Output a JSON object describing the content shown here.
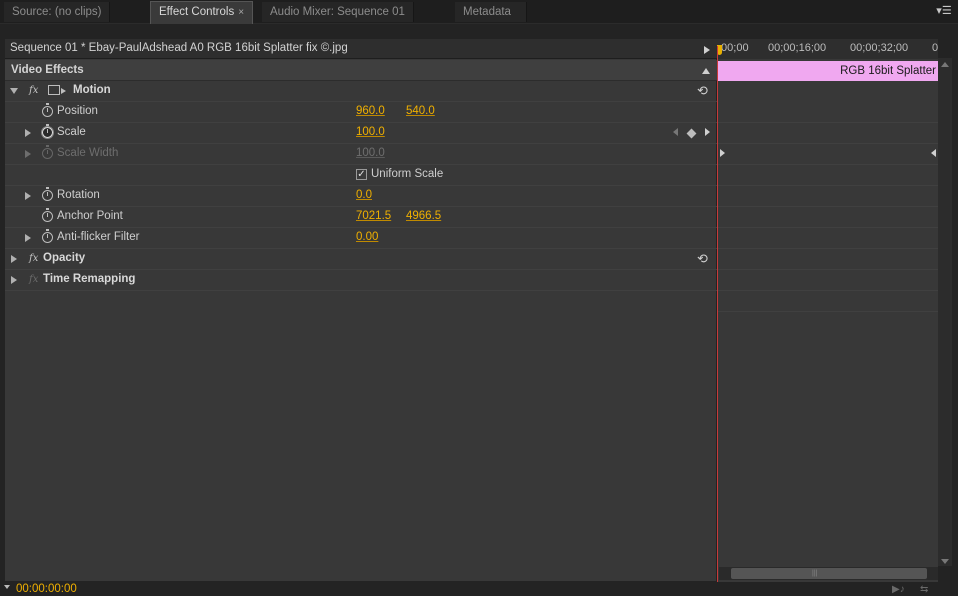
{
  "tabs": [
    {
      "label": "Source: (no clips)",
      "active": false
    },
    {
      "label": "Effect Controls",
      "active": true,
      "close": "×"
    },
    {
      "label": "Audio Mixer: Sequence 01",
      "active": false
    },
    {
      "label": "Metadata",
      "active": false
    }
  ],
  "panel_menu_icon": "▾☰",
  "clip_bar": {
    "name": "Sequence 01 * Ebay-PaulAdshead A0 RGB 16bit Splatter fix ©.jpg"
  },
  "video_effects": {
    "title": "Video Effects"
  },
  "effects": {
    "motion": {
      "label": "Motion",
      "fx": "fx",
      "reset_icon": "⟲",
      "properties": {
        "position": {
          "label": "Position",
          "x": "960.0",
          "y": "540.0"
        },
        "scale": {
          "label": "Scale",
          "value": "100.0"
        },
        "scale_width": {
          "label": "Scale Width",
          "value": "100.0"
        },
        "uniform_scale": {
          "label": "Uniform Scale",
          "checked": true,
          "check": "✓"
        },
        "rotation": {
          "label": "Rotation",
          "value": "0.0"
        },
        "anchor_point": {
          "label": "Anchor Point",
          "x": "7021.5",
          "y": "4966.5"
        },
        "anti_flicker": {
          "label": "Anti-flicker Filter",
          "value": "0.00"
        }
      }
    },
    "opacity": {
      "label": "Opacity",
      "fx": "fx",
      "reset_icon": "⟲"
    },
    "time_remapping": {
      "label": "Time Remapping",
      "fx": "fx"
    }
  },
  "timeline": {
    "ticks": [
      ";00;00",
      "00;00;16;00",
      "00;00;32;00",
      "0"
    ],
    "clip_label": "RGB 16bit Splatter",
    "clip_color": "#f0a8f0",
    "playhead_color": "#e8b000"
  },
  "status": {
    "timecode": "00:00:00:00",
    "accent_color": "#f0b000"
  }
}
